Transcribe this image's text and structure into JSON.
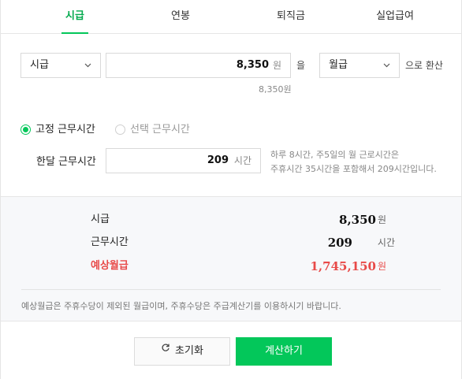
{
  "tabs": [
    {
      "label": "시급",
      "active": true
    },
    {
      "label": "연봉",
      "active": false
    },
    {
      "label": "퇴직금",
      "active": false
    },
    {
      "label": "실업급여",
      "active": false
    }
  ],
  "converter": {
    "from_unit": "시급",
    "amount": "8,350",
    "amount_unit": "원",
    "particle": "을",
    "to_unit": "월급",
    "suffix": "으로 환산",
    "amount_hint": "8,350원"
  },
  "work_hours": {
    "radio_fixed": "고정 근무시간",
    "radio_optional": "선택 근무시간",
    "label": "한달 근무시간",
    "value": "209",
    "unit": "시간",
    "help_line1": "하루 8시간, 주5일의 월 근로시간은",
    "help_line2": "주휴시간 35시간을 포함해서 209시간입니다."
  },
  "summary": {
    "rows": [
      {
        "label": "시급",
        "value": "8,350",
        "unit": "원"
      },
      {
        "label": "근무시간",
        "value": "209",
        "unit": "시간"
      },
      {
        "label": "예상월급",
        "value": "1,745,150",
        "unit": "원"
      }
    ],
    "note": "예상월급은 주휴수당이 제외된 월급이며, 주휴수당은 주급계산기를 이용하시기 바랍니다.",
    "highlight_color": "#e84a48"
  },
  "buttons": {
    "reset": "초기화",
    "calculate": "계산하기"
  },
  "colors": {
    "accent": "#03c75a",
    "warning": "#e84a48"
  }
}
